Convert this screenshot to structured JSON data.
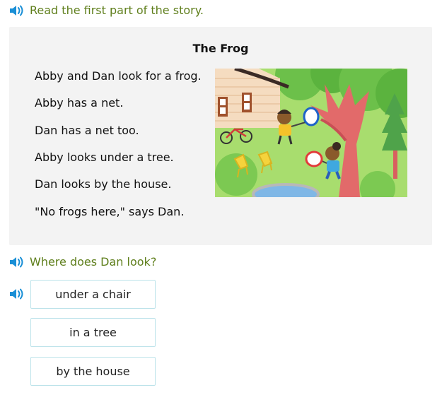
{
  "instruction": {
    "text": "Read the first part of the story."
  },
  "story": {
    "title": "The Frog",
    "lines": [
      "Abby and Dan look for a frog.",
      "Abby has a net.",
      "Dan has a net too.",
      "Abby looks under a tree.",
      "Dan looks by the house.",
      "\"No frogs here,\" says Dan."
    ]
  },
  "question": {
    "text": "Where does Dan look?"
  },
  "choices": [
    "under a chair",
    "in a tree",
    "by the house"
  ],
  "colors": {
    "prompt_text": "#5f7f1c",
    "speaker_icon": "#1a8fd6",
    "story_background": "#f3f3f3",
    "choice_border": "#bde3ea"
  },
  "icons": {
    "audio": "speaker-icon"
  }
}
